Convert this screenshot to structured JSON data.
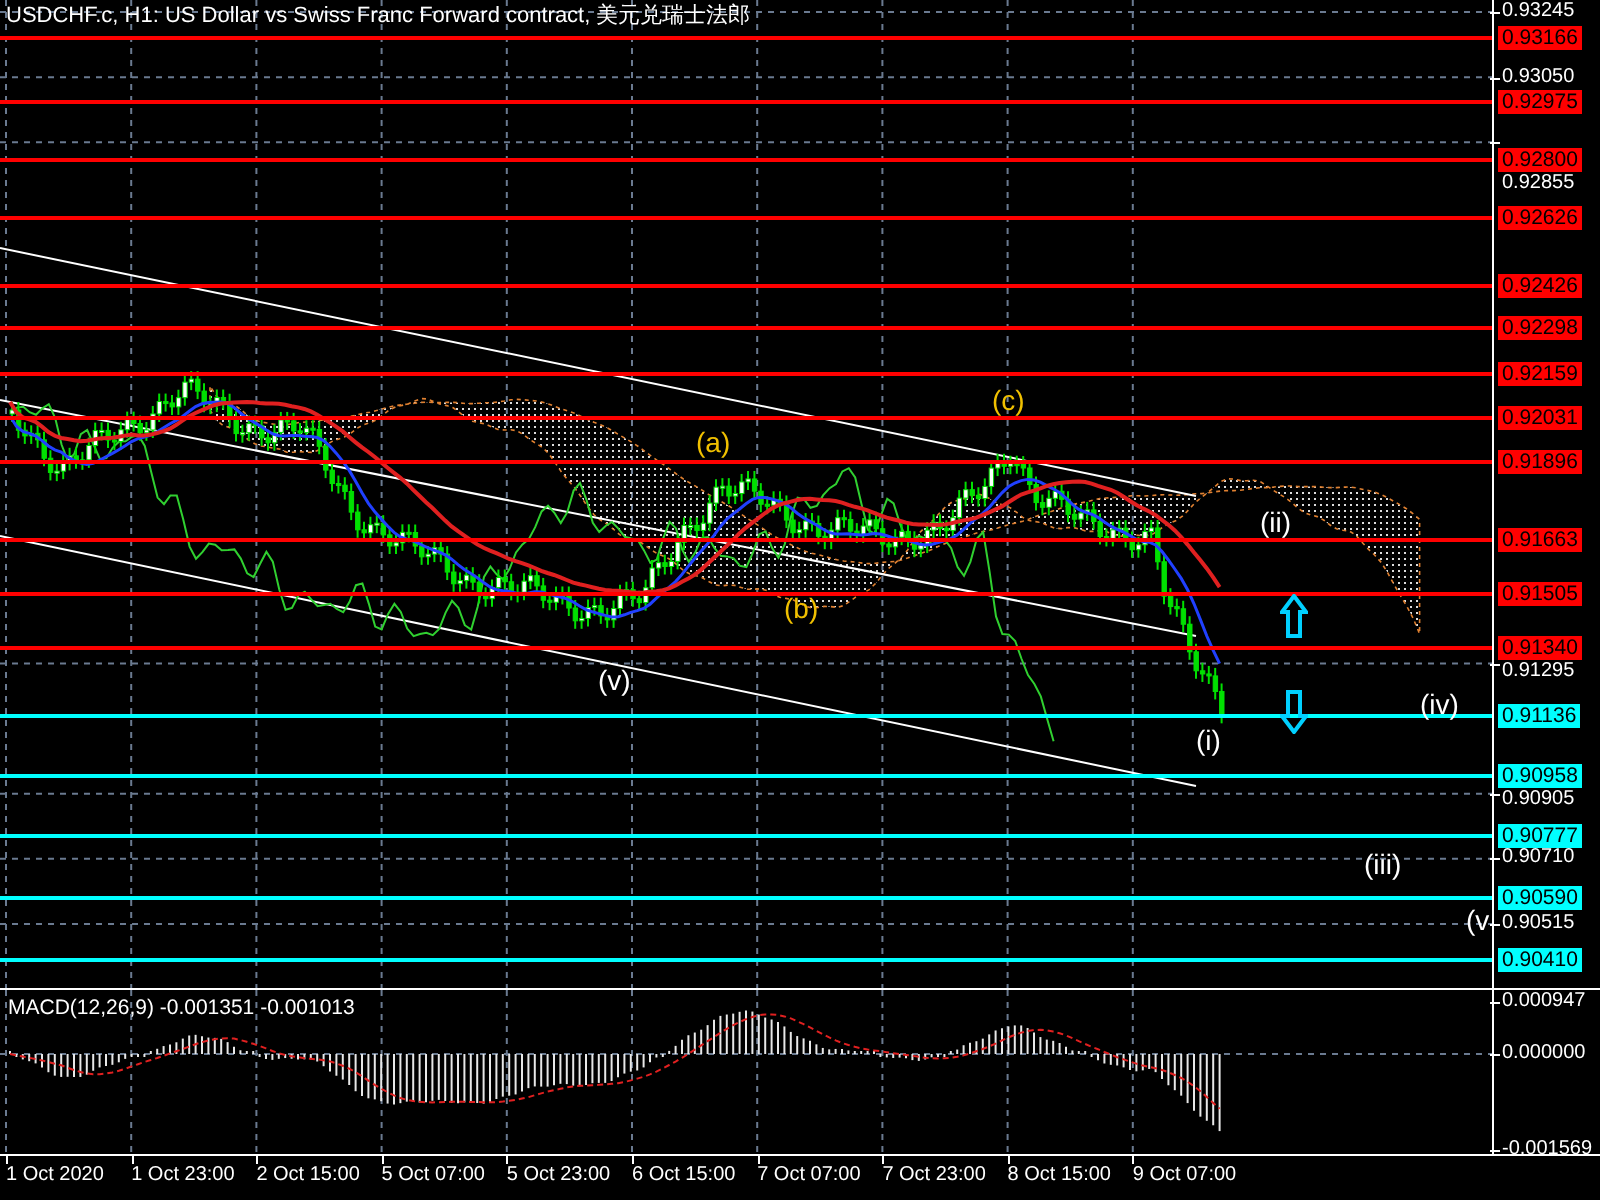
{
  "title": "USDCHF.c, H1:  US Dollar vs Swiss Franc Forward contract, 美元兑瑞士法郎",
  "price_axis": {
    "ticks": [
      "0.93245",
      "0.93050",
      "0.92855",
      "0.91295",
      "0.90905",
      "0.90710",
      "0.90515"
    ]
  },
  "levels": [
    {
      "price": "0.93166",
      "color": "#ff0000"
    },
    {
      "price": "0.92975",
      "color": "#ff0000"
    },
    {
      "price": "0.92800",
      "color": "#ff0000"
    },
    {
      "price": "0.92626",
      "color": "#ff0000"
    },
    {
      "price": "0.92426",
      "color": "#ff0000"
    },
    {
      "price": "0.92298",
      "color": "#ff0000"
    },
    {
      "price": "0.92159",
      "color": "#ff0000"
    },
    {
      "price": "0.92031",
      "color": "#ff0000"
    },
    {
      "price": "0.91896",
      "color": "#ff0000"
    },
    {
      "price": "0.91663",
      "color": "#ff0000"
    },
    {
      "price": "0.91505",
      "color": "#ff0000"
    },
    {
      "price": "0.91340",
      "color": "#ff0000"
    },
    {
      "price": "0.91136",
      "color": "#00ffff"
    },
    {
      "price": "0.90958",
      "color": "#00ffff"
    },
    {
      "price": "0.90777",
      "color": "#00ffff"
    },
    {
      "price": "0.90590",
      "color": "#00ffff"
    },
    {
      "price": "0.90410",
      "color": "#00ffff"
    }
  ],
  "wave_labels": [
    {
      "text": "(a)",
      "color": "#f0c000"
    },
    {
      "text": "(b)",
      "color": "#f0c000"
    },
    {
      "text": "(c)",
      "color": "#f0c000"
    },
    {
      "text": "(v)",
      "color": "#ffffff"
    },
    {
      "text": "(i)",
      "color": "#ffffff"
    },
    {
      "text": "(ii)",
      "color": "#ffffff"
    },
    {
      "text": "(iii)",
      "color": "#ffffff"
    },
    {
      "text": "(iv)",
      "color": "#ffffff"
    },
    {
      "text": "(v",
      "color": "#ffffff"
    }
  ],
  "arrows": [
    {
      "kind": "up"
    },
    {
      "kind": "down"
    }
  ],
  "macd": {
    "label": "MACD(12,26,9) -0.001351 -0.001013",
    "ticks": [
      "0.000947",
      "0.000000",
      "-0.001569"
    ]
  },
  "time_axis": [
    "1 Oct 2020",
    "1 Oct 23:00",
    "2 Oct 15:00",
    "5 Oct 07:00",
    "5 Oct 23:00",
    "6 Oct 15:00",
    "7 Oct 07:00",
    "7 Oct 23:00",
    "8 Oct 15:00",
    "9 Oct 07:00"
  ]
}
